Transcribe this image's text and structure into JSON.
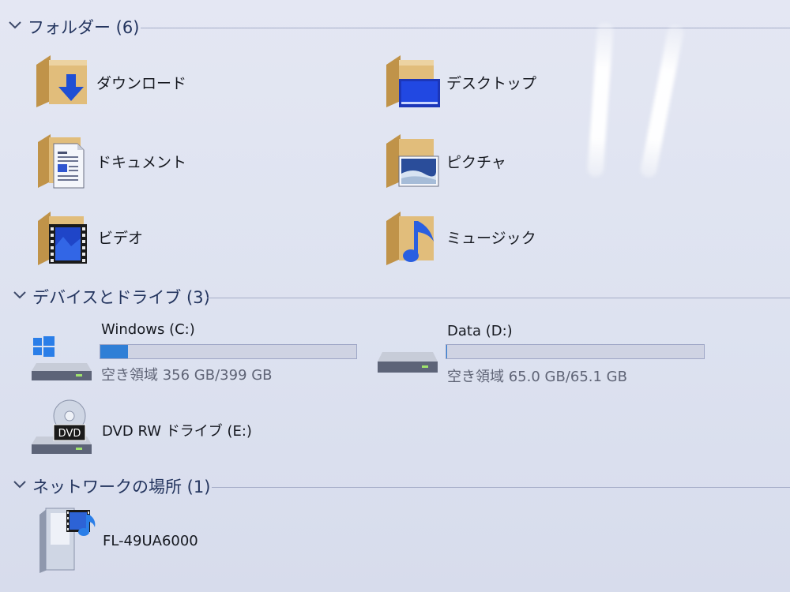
{
  "sections": {
    "folders": {
      "title": "フォルダー (6)"
    },
    "devices": {
      "title": "デバイスとドライブ (3)"
    },
    "network": {
      "title": "ネットワークの場所 (1)"
    }
  },
  "folders": [
    {
      "label": "ダウンロード",
      "icon": "download-folder-icon"
    },
    {
      "label": "デスクトップ",
      "icon": "desktop-folder-icon"
    },
    {
      "label": "ドキュメント",
      "icon": "documents-folder-icon"
    },
    {
      "label": "ピクチャ",
      "icon": "pictures-folder-icon"
    },
    {
      "label": "ビデオ",
      "icon": "videos-folder-icon"
    },
    {
      "label": "ミュージック",
      "icon": "music-folder-icon"
    }
  ],
  "drives": [
    {
      "name": "Windows (C:)",
      "free_text": "空き領域 356 GB/399 GB",
      "used_fraction": 0.108,
      "icon": "windows-drive-icon"
    },
    {
      "name": "Data (D:)",
      "free_text": "空き領域 65.0 GB/65.1 GB",
      "used_fraction": 0.002,
      "icon": "hard-drive-icon"
    },
    {
      "name": "DVD RW ドライブ (E:)",
      "icon": "dvd-drive-icon",
      "badge": "DVD"
    }
  ],
  "network": [
    {
      "name": "FL-49UA6000",
      "icon": "media-device-icon"
    }
  ],
  "colors": {
    "accent": "#2f7fd6",
    "header_text": "#23345e",
    "folder": "#dcb36a"
  }
}
